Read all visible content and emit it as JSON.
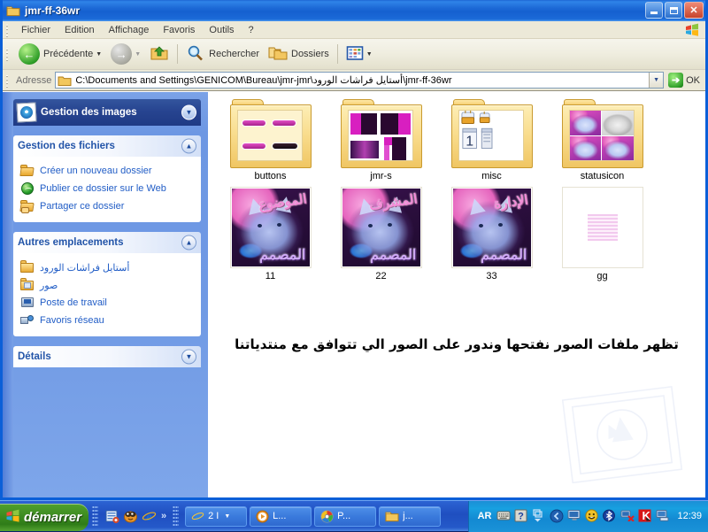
{
  "window": {
    "title": "jmr-ff-36wr",
    "icon": "folder-icon",
    "controls": {
      "minimize": "_",
      "maximize": "❐",
      "close": "✕"
    }
  },
  "menubar": {
    "items": [
      {
        "label": "Fichier"
      },
      {
        "label": "Edition"
      },
      {
        "label": "Affichage"
      },
      {
        "label": "Favoris"
      },
      {
        "label": "Outils"
      },
      {
        "label": "?"
      }
    ]
  },
  "toolbar": {
    "back_label": "Précédente",
    "search_label": "Rechercher",
    "folders_label": "Dossiers",
    "dropdown_glyph": "▼"
  },
  "address": {
    "label": "Adresse",
    "value": "C:\\Documents and Settings\\GENICOM\\Bureau\\jmr-jmr\\أستايل فراشات الورود\\jmr-ff-36wr",
    "go_label": "OK",
    "go_glyph": "➔",
    "dropdown_glyph": "▼"
  },
  "sidebar": {
    "panels": [
      {
        "title": "Gestion des images",
        "style": "dark",
        "chevron": "▼",
        "items": []
      },
      {
        "title": "Gestion des fichiers",
        "style": "light",
        "chevron": "▲",
        "items": [
          {
            "label": "Créer un nouveau dossier",
            "icon": "new-folder-icon",
            "rtl": false
          },
          {
            "label": "Publier ce dossier sur le Web",
            "icon": "globe-icon",
            "rtl": false
          },
          {
            "label": "Partager ce dossier",
            "icon": "share-folder-icon",
            "rtl": false
          }
        ]
      },
      {
        "title": "Autres emplacements",
        "style": "light",
        "chevron": "▲",
        "items": [
          {
            "label": "أستايل فراشات الورود",
            "icon": "folder-icon",
            "rtl": true
          },
          {
            "label": "صور",
            "icon": "pictures-folder-icon",
            "rtl": true
          },
          {
            "label": "Poste de travail",
            "icon": "my-computer-icon",
            "rtl": false
          },
          {
            "label": "Favoris réseau",
            "icon": "network-icon",
            "rtl": false
          }
        ]
      },
      {
        "title": "Détails",
        "style": "light-collapsed",
        "chevron": "▼",
        "items": []
      }
    ]
  },
  "content": {
    "items": [
      {
        "name": "buttons",
        "type": "folder",
        "art": "buttons"
      },
      {
        "name": "jmr-s",
        "type": "folder",
        "art": "jmrs"
      },
      {
        "name": "misc",
        "type": "folder",
        "art": "misc"
      },
      {
        "name": "statusicon",
        "type": "folder",
        "art": "statusicon"
      },
      {
        "name": "11",
        "type": "image",
        "art": "cat",
        "overlay_top": "الموضوع",
        "overlay_bottom": "المصمم"
      },
      {
        "name": "22",
        "type": "image",
        "art": "cat",
        "overlay_top": "المشرف",
        "overlay_bottom": "المصمم"
      },
      {
        "name": "33",
        "type": "image",
        "art": "cat",
        "overlay_top": "الإدارة",
        "overlay_bottom": "المصمم"
      },
      {
        "name": "gg",
        "type": "image",
        "art": "gg",
        "overlay_top": "",
        "overlay_bottom": ""
      }
    ],
    "annotation": "تظهر ملفات الصور نفتحها وندور على الصور الي تتوافق مع منتدياتنا"
  },
  "taskbar": {
    "start_label": "démarrer",
    "quicklaunch": [
      {
        "icon": "show-desktop-icon"
      },
      {
        "icon": "media-player-icon"
      },
      {
        "icon": "internet-explorer-icon"
      }
    ],
    "quicklaunch_more": "»",
    "tasks": [
      {
        "label": "2 I",
        "icon": "internet-explorer-icon",
        "dropdown": "▼"
      },
      {
        "label": "L...",
        "icon": "media-player-icon",
        "dropdown": ""
      },
      {
        "label": "P...",
        "icon": "paint-icon",
        "dropdown": ""
      },
      {
        "label": "j...",
        "icon": "folder-icon",
        "dropdown": ""
      }
    ],
    "tray": {
      "language": "AR",
      "icons": [
        {
          "icon": "keyboard-icon"
        },
        {
          "icon": "help-icon"
        },
        {
          "icon": "windows-update-icon"
        },
        {
          "icon": "hide-tray-icon"
        },
        {
          "icon": "network-activity-icon"
        },
        {
          "icon": "smiley-icon"
        },
        {
          "icon": "bluetooth-icon"
        },
        {
          "icon": "network-error-icon"
        },
        {
          "icon": "kaspersky-icon"
        },
        {
          "icon": "display-icon"
        }
      ],
      "clock": "12:39"
    }
  },
  "colors": {
    "title_blue": "#1d69d6",
    "sidebar_blue": "#6f99e4",
    "panel_header_blue": "#2254a8",
    "link_blue": "#215dc6",
    "start_green": "#3f8e22",
    "taskbar_blue": "#2559c9",
    "folder_yellow": "#f3c761"
  }
}
